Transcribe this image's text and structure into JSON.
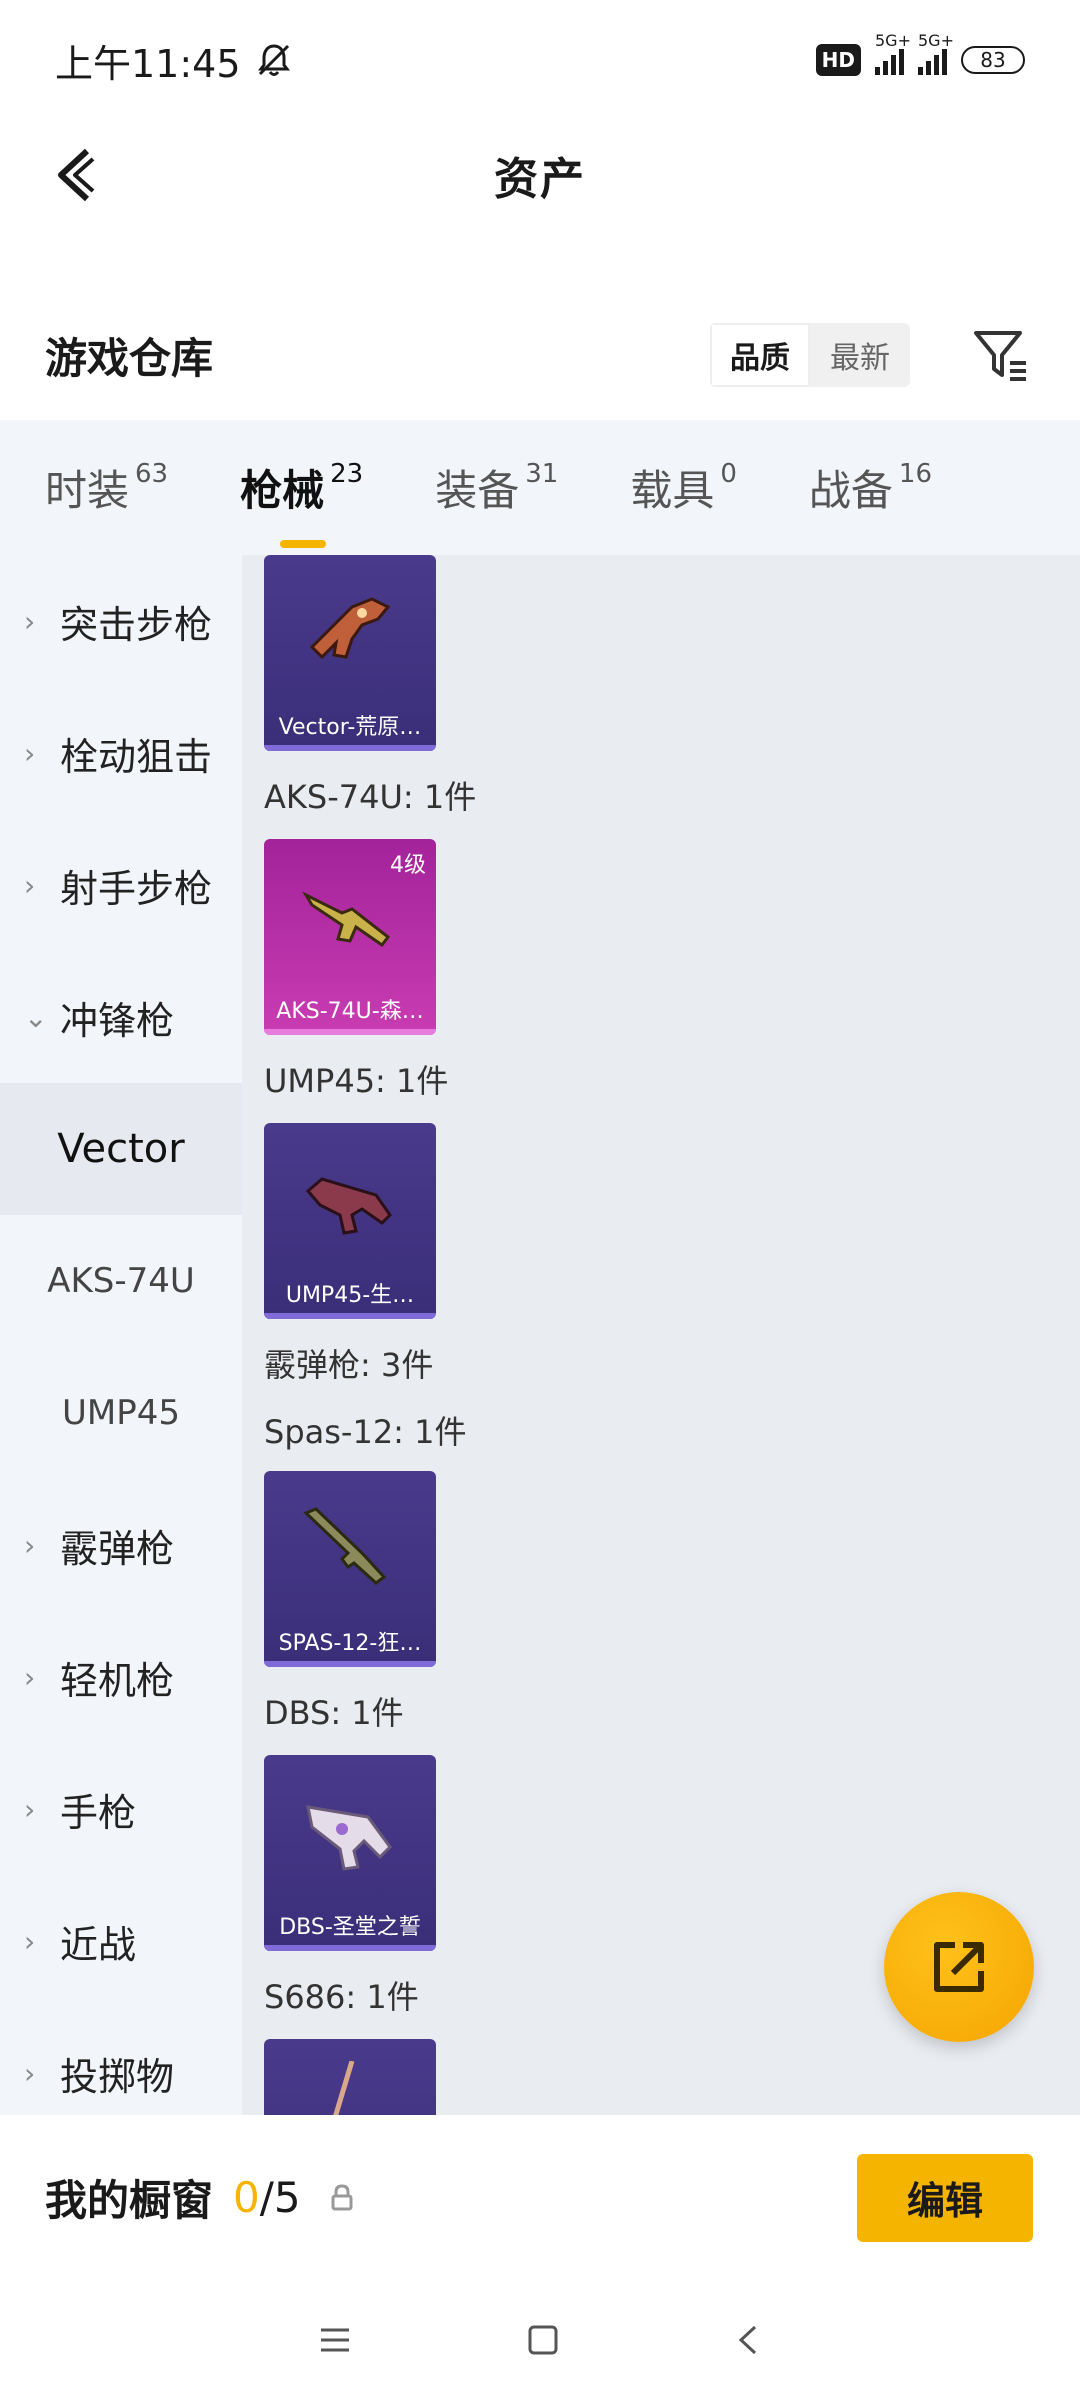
{
  "status": {
    "time": "上午11:45",
    "hd": "HD",
    "net1": "5G+",
    "net2": "5G+",
    "battery": "83"
  },
  "header": {
    "title": "资产"
  },
  "warehouse": {
    "title": "游戏仓库",
    "sort_options": [
      "品质",
      "最新"
    ],
    "active_sort": "品质"
  },
  "categories": [
    {
      "name": "时装",
      "count": "63"
    },
    {
      "name": "枪械",
      "count": "23"
    },
    {
      "name": "装备",
      "count": "31"
    },
    {
      "name": "载具",
      "count": "0"
    },
    {
      "name": "战备",
      "count": "16"
    }
  ],
  "sidebar": {
    "items": [
      "突击步枪",
      "栓动狙击",
      "射手步枪",
      "冲锋枪"
    ],
    "sub_items": [
      "Vector",
      "AKS-74U",
      "UMP45"
    ],
    "items_after": [
      "霰弹枪",
      "轻机枪",
      "手枪",
      "近战",
      "投掷物"
    ]
  },
  "content": {
    "card_vector": "Vector-荒原…",
    "label_aks": "AKS-74U: 1件",
    "card_aks": "AKS-74U-森…",
    "card_aks_level": "4级",
    "label_ump": "UMP45: 1件",
    "card_ump": "UMP45-生…",
    "label_shotgun": "霰弹枪: 3件",
    "label_spas": "Spas-12: 1件",
    "card_spas": "SPAS-12-狂…",
    "label_dbs": "DBS: 1件",
    "card_dbs": "DBS-圣堂之誓",
    "label_s686": "S686: 1件"
  },
  "showcase": {
    "title": "我的橱窗",
    "current": "0",
    "sep_total": "/5",
    "edit_label": "编辑"
  },
  "colors": {
    "accent": "#f5b400",
    "card_purple": "#3a2e78",
    "card_pink": "#c93cb2"
  }
}
